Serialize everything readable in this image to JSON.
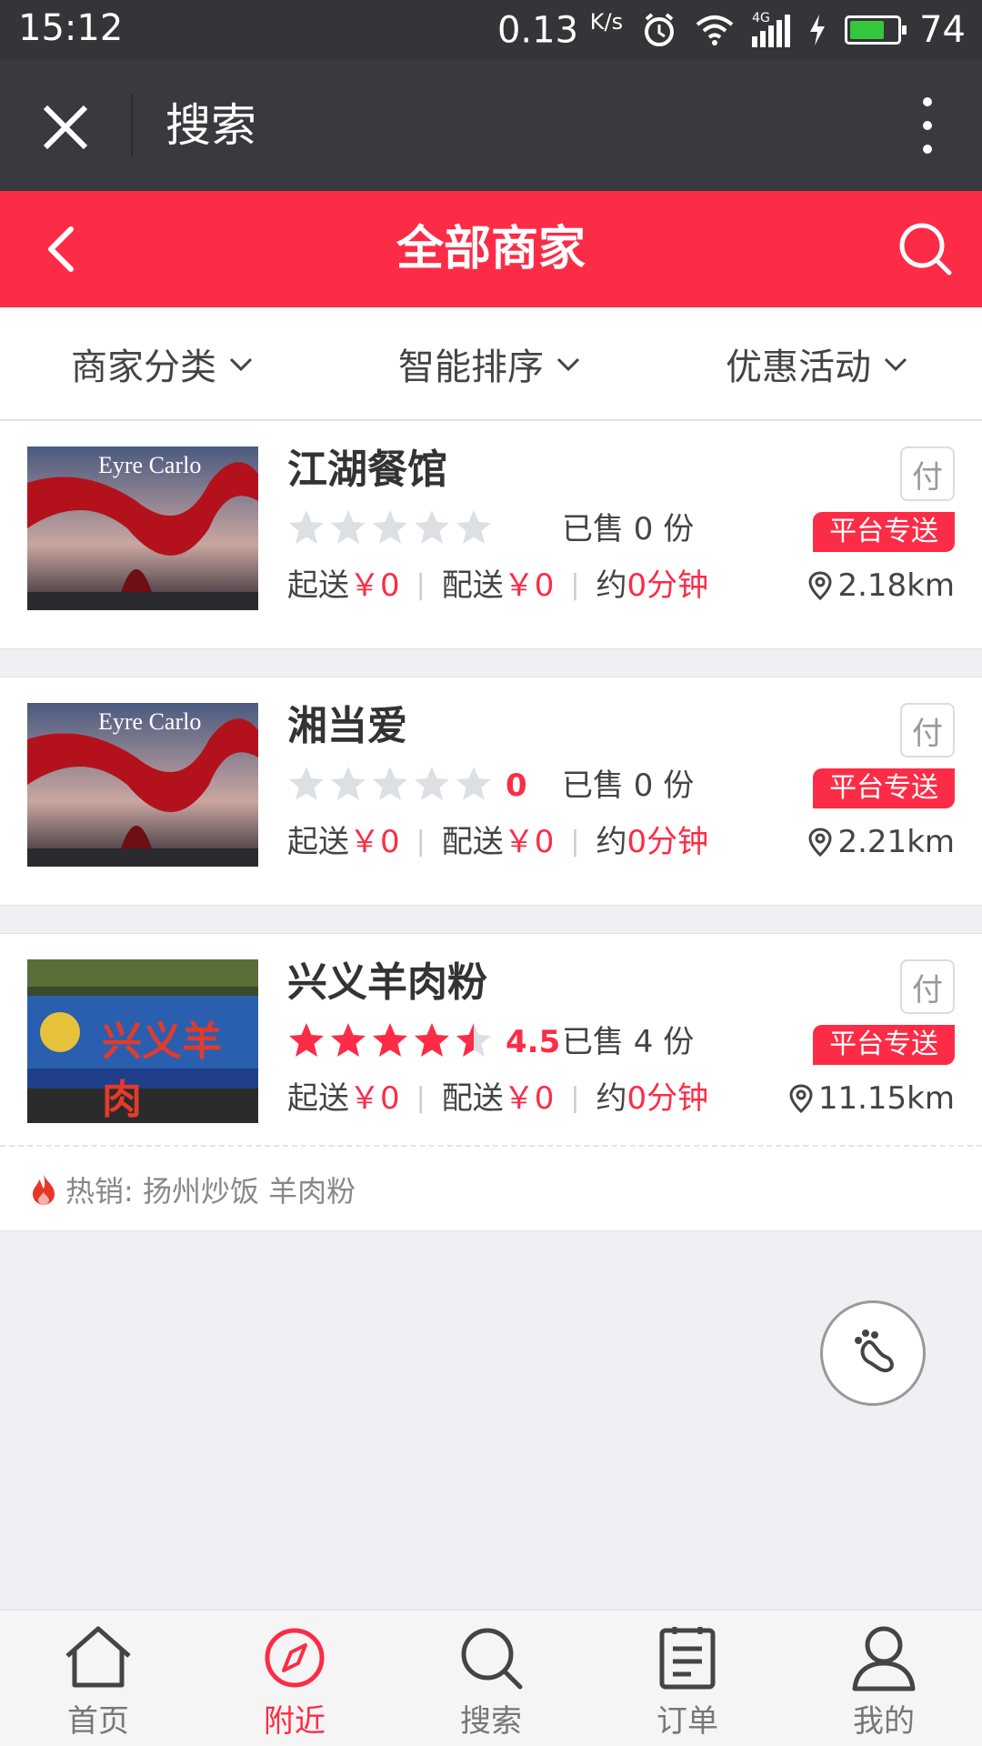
{
  "status_bar": {
    "time": "15:12",
    "speed": "0.13",
    "speed_unit": "K/s",
    "network": "4G",
    "battery": "74"
  },
  "webview": {
    "title": "搜索",
    "close_icon": "close-icon",
    "more_icon": "more-vertical-icon"
  },
  "header": {
    "title": "全部商家",
    "accent_color": "#fc2c46"
  },
  "filters": [
    {
      "label": "商家分类"
    },
    {
      "label": "智能排序"
    },
    {
      "label": "优惠活动"
    }
  ],
  "shops": [
    {
      "name": "江湖餐馆",
      "image_caption": "Eyre Carlo",
      "rating_num": "",
      "rating": 0,
      "sold": "已售 0 份",
      "min_order_label": "起送",
      "min_order": "￥0",
      "delivery_fee_label": "配送",
      "delivery_fee": "￥0",
      "time_label": "约",
      "time": "0分钟",
      "pay_badge": "付",
      "delivery_badge": "平台专送",
      "distance": "2.18km"
    },
    {
      "name": "湘当爱",
      "image_caption": "Eyre Carlo",
      "rating_num": "0",
      "rating": 0,
      "sold": "已售 0 份",
      "min_order_label": "起送",
      "min_order": "￥0",
      "delivery_fee_label": "配送",
      "delivery_fee": "￥0",
      "time_label": "约",
      "time": "0分钟",
      "pay_badge": "付",
      "delivery_badge": "平台专送",
      "distance": "2.21km"
    },
    {
      "name": "兴义羊肉粉",
      "image_caption": "兴义羊肉",
      "rating_num": "4.5",
      "rating": 4.5,
      "sold": "已售 4 份",
      "min_order_label": "起送",
      "min_order": "￥0",
      "delivery_fee_label": "配送",
      "delivery_fee": "￥0",
      "time_label": "约",
      "time": "0分钟",
      "pay_badge": "付",
      "delivery_badge": "平台专送",
      "distance": "11.15km",
      "hot": "热销: 扬州炒饭 羊肉粉"
    }
  ],
  "bottom_nav": [
    {
      "label": "首页",
      "icon": "home-icon",
      "active": false
    },
    {
      "label": "附近",
      "icon": "compass-icon",
      "active": true
    },
    {
      "label": "搜索",
      "icon": "search-icon",
      "active": false
    },
    {
      "label": "订单",
      "icon": "order-list-icon",
      "active": false
    },
    {
      "label": "我的",
      "icon": "user-icon",
      "active": false
    }
  ]
}
